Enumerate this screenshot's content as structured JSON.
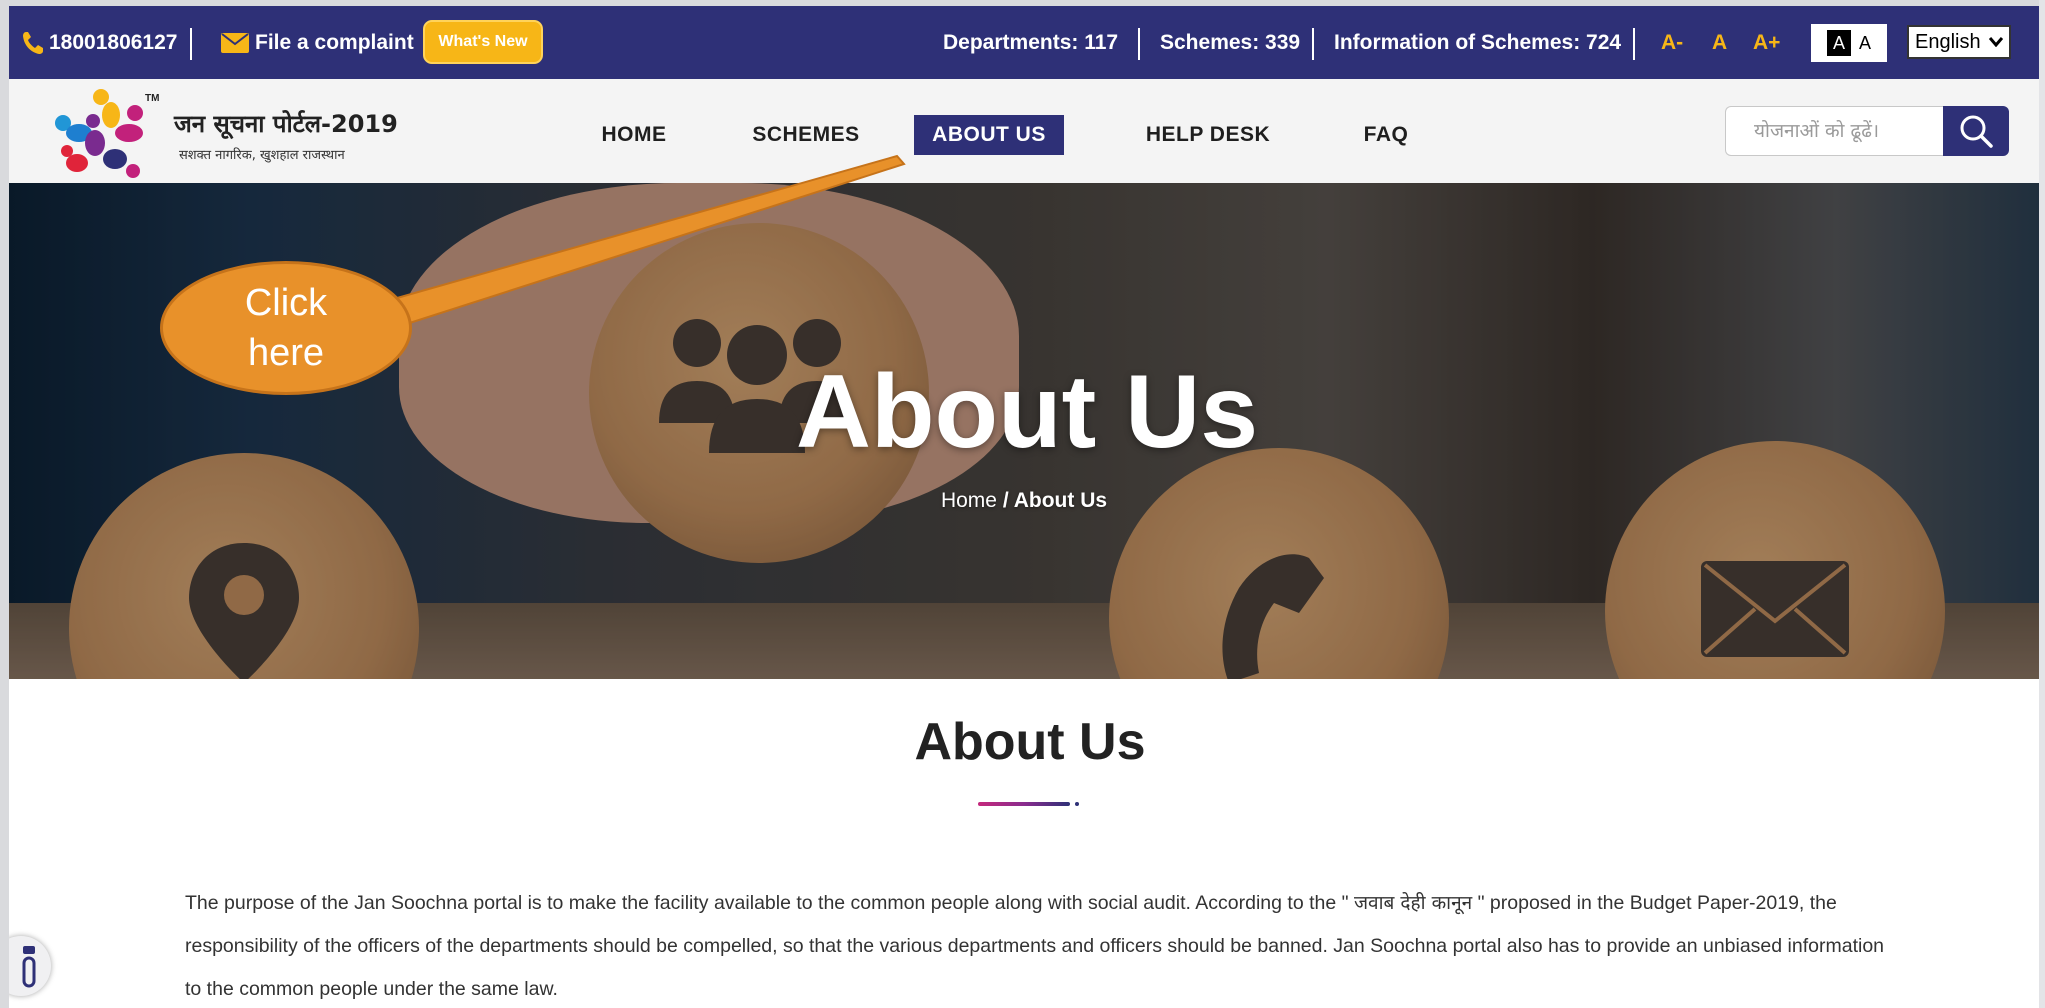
{
  "topbar": {
    "phone": "18001806127",
    "complaint_label": "File a complaint",
    "whats_new_label": "What's New",
    "departments": "Departments: 117",
    "schemes": "Schemes: 339",
    "info_schemes": "Information of Schemes: 724",
    "font_small": "A-",
    "font_normal": "A",
    "font_large": "A+",
    "contrast_dark": "A",
    "contrast_light": "A",
    "language": "English"
  },
  "brand": {
    "title": "जन सूचना पोर्टल-2019",
    "tagline": "सशक्त नागरिक, खुशहाल राजस्थान",
    "colors": {
      "navy": "#2e3077",
      "yellow": "#f7b617",
      "orange": "#e8912a"
    }
  },
  "nav": {
    "items": [
      {
        "label": "HOME"
      },
      {
        "label": "SCHEMES"
      },
      {
        "label": "ABOUT US"
      },
      {
        "label": "HELP DESK"
      },
      {
        "label": "FAQ"
      }
    ],
    "active": "ABOUT US",
    "search_placeholder": "योजनाओं को ढूढें।"
  },
  "hero": {
    "title": "About Us",
    "breadcrumb_home": "Home",
    "breadcrumb_sep": " / ",
    "breadcrumb_current": "About Us"
  },
  "callout": {
    "text": "Click\nhere"
  },
  "content": {
    "heading": "About Us",
    "para_part1": "The purpose of the Jan Soochna portal is to make the facility available to the common people along with social audit. According to the \" ",
    "para_hindi": "जवाब देही कानून",
    "para_part2": " \" proposed in the Budget Paper-2019, the responsibility of the officers of the departments should be compelled, so that the various departments and officers should be banned. Jan Soochna portal also has to provide an unbiased information to the common people under the same law."
  }
}
